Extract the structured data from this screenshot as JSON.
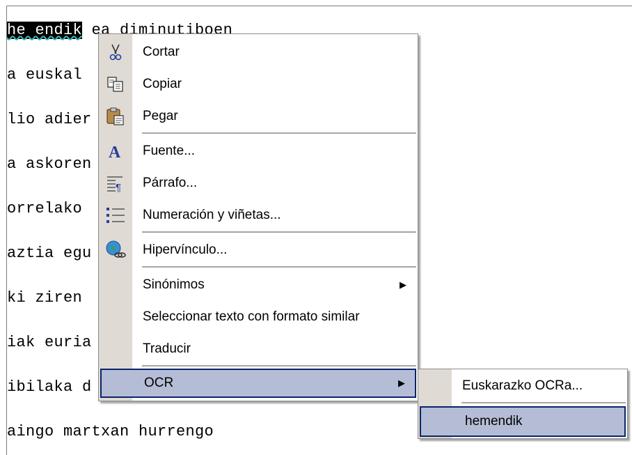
{
  "document": {
    "lines": [
      {
        "pre": "",
        "selected": "he endik",
        "post": " ea diminutiboen"
      },
      {
        "pre": "",
        "selected": "",
        "post": "a euskal"
      },
      {
        "pre": "",
        "selected": "",
        "post": "lio adier"
      },
      {
        "pre": "",
        "selected": "",
        "post": "a askoren"
      },
      {
        "pre": "",
        "selected": "",
        "post": "orrelako"
      },
      {
        "pre": "",
        "selected": "",
        "post": "aztia egu"
      },
      {
        "pre": "",
        "selected": "",
        "post": "ki ziren"
      },
      {
        "pre": "",
        "selected": "",
        "post": "iak euria"
      },
      {
        "pre": "",
        "selected": "",
        "post": "ibilaka d"
      },
      {
        "pre": "",
        "selected": "",
        "post": "aingo martxan hurrengo"
      }
    ]
  },
  "context_menu": {
    "items": [
      {
        "label": "Cortar",
        "icon": "scissors-icon"
      },
      {
        "label": "Copiar",
        "icon": "copy-icon"
      },
      {
        "label": "Pegar",
        "icon": "paste-icon"
      },
      {
        "label": "Fuente...",
        "icon": "font-icon"
      },
      {
        "label": "Párrafo...",
        "icon": "paragraph-icon"
      },
      {
        "label": "Numeración y viñetas...",
        "icon": "bullets-icon"
      },
      {
        "label": "Hipervínculo...",
        "icon": "hyperlink-icon"
      },
      {
        "label": "Sinónimos",
        "icon": null,
        "has_submenu": true
      },
      {
        "label": "Seleccionar texto con formato similar",
        "icon": null
      },
      {
        "label": "Traducir",
        "icon": null
      },
      {
        "label": "OCR",
        "icon": null,
        "has_submenu": true,
        "highlighted": true
      }
    ]
  },
  "submenu": {
    "items": [
      {
        "label": "Euskarazko OCRa..."
      },
      {
        "label": "hemendik",
        "highlighted": true
      }
    ]
  },
  "colors": {
    "highlight_bg": "#b5bdd6",
    "highlight_border": "#0a246a",
    "gutter": "#dfdbd4"
  }
}
